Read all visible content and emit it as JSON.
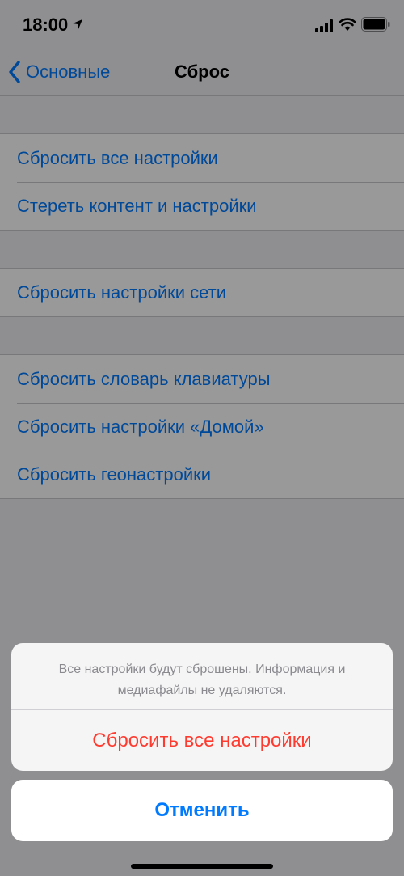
{
  "status_bar": {
    "time": "18:00"
  },
  "nav": {
    "back_label": "Основные",
    "title": "Сброс"
  },
  "groups": [
    {
      "items": [
        "Сбросить все настройки",
        "Стереть контент и настройки"
      ]
    },
    {
      "items": [
        "Сбросить настройки сети"
      ]
    },
    {
      "items": [
        "Сбросить словарь клавиатуры",
        "Сбросить настройки «Домой»",
        "Сбросить геонастройки"
      ]
    }
  ],
  "action_sheet": {
    "message": "Все настройки будут сброшены. Информация и медиафайлы не удаляются.",
    "destructive_label": "Сбросить все настройки",
    "cancel_label": "Отменить"
  },
  "colors": {
    "accent": "#007aff",
    "destructive": "#ff3b30",
    "background": "#efeff4"
  },
  "icons": [
    "location-arrow-icon",
    "cellular-signal-icon",
    "wifi-icon",
    "battery-icon",
    "chevron-left-icon"
  ]
}
